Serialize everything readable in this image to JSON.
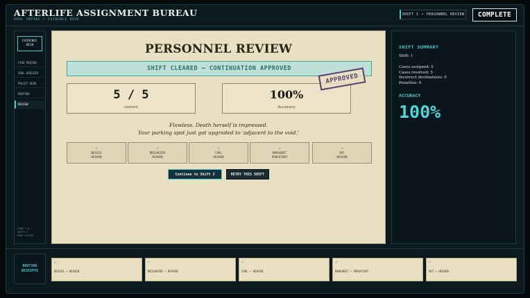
{
  "header": {
    "title": "AFTERLIFE ASSIGNMENT BUREAU",
    "subtitle": "SOUL INTAKE • EVIDENCE DESK",
    "shift_label": "SHIFT 1",
    "shift_sep": "•",
    "shift_view": "PERSONNEL REVIEW",
    "status": "COMPLETE"
  },
  "nav": {
    "title_line1": "EVIDENCE",
    "title_line2": "DESK",
    "items": [
      "CASE REVIEW",
      "SOUL DOSSIER",
      "POLICY DESK",
      "ROUTING",
      "REVIEW"
    ],
    "footer": [
      "FORM 7-A",
      "SHIFT 1",
      "DIRK ACTIVE"
    ]
  },
  "review": {
    "heading": "PERSONNEL REVIEW",
    "banner": "SHIFT CLEARED — CONTINUATION APPROVED",
    "stamp": "APPROVED",
    "score_value": "5 / 5",
    "score_label": "correct",
    "accuracy_value": "100%",
    "accuracy_label": "Accuracy",
    "quote_line1": "Flawless. Death herself is impressed.",
    "quote_line2": "Your parking spot just got upgraded to 'adjacent to the void.'",
    "cases": [
      {
        "check": "✓",
        "name": "BESSIE",
        "dest": "HEAVEN"
      },
      {
        "check": "✓",
        "name": "BRIGADIER",
        "dest": "HEAVEN"
      },
      {
        "check": "✓",
        "name": "CARL",
        "dest": "HEAVEN"
      },
      {
        "check": "✓",
        "name": "MARGARET",
        "dest": "PURGATORY"
      },
      {
        "check": "✓",
        "name": "DOT",
        "dest": "HEAVEN"
      }
    ],
    "continue_label": "Continue to Shift 2",
    "retry_label": "RETRY THIS SHIFT"
  },
  "summary": {
    "heading": "SHIFT SUMMARY",
    "shift": "Shift: 1",
    "assigned": "Cases assigned: 5",
    "resolved": "Cases resolved: 5",
    "incorrect": "Incorrect destinations: 0",
    "penalties": "Penalties: 0",
    "accuracy_heading": "ACCURACY",
    "accuracy_value": "100%"
  },
  "receipts": {
    "label_line1": "ROUTING",
    "label_line2": "RECEIPTS",
    "items": [
      {
        "check": "✓",
        "text": "BESSIE → HEAVEN"
      },
      {
        "check": "✓",
        "text": "BRIGADIER → HEAVEN"
      },
      {
        "check": "✓",
        "text": "CARL → HEAVEN"
      },
      {
        "check": "✓",
        "text": "MARGARET → PURGATORY"
      },
      {
        "check": "✓",
        "text": "DOT → HEAVEN"
      }
    ]
  },
  "colors": {
    "accent": "#4fc9cf",
    "paper": "#e9dfc2",
    "stamp": "#5a3e6e",
    "banner_bg": "#bfe0d6"
  }
}
